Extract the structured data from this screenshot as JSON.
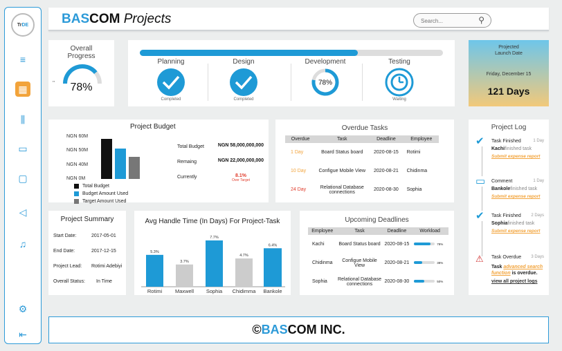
{
  "app": {
    "logo_text_a": "Tr",
    "logo_text_b": "DE",
    "title_blue": "BAS",
    "title_rest": "COM",
    "title_italic": "Projects"
  },
  "search": {
    "placeholder": "Search..."
  },
  "sidebar": {
    "items": [
      "menu-icon",
      "dashboard-icon",
      "filters-icon",
      "calendar-icon",
      "chat-icon",
      "send-icon",
      "bell-icon",
      "settings-icon",
      "collapse-icon"
    ]
  },
  "overall": {
    "title_line1": "Overall",
    "title_line2": "Progress",
    "value": "78%",
    "fraction": 0.78,
    "quote": "''"
  },
  "phases": {
    "progress_fraction": 0.72,
    "items": [
      {
        "name": "Planning",
        "status": "Completed",
        "state": "done"
      },
      {
        "name": "Design",
        "status": "Completed",
        "state": "done"
      },
      {
        "name": "Development",
        "status": "",
        "state": "progress",
        "value": "78%",
        "fraction": 0.78
      },
      {
        "name": "Testing",
        "status": "Waiting",
        "state": "waiting"
      }
    ]
  },
  "launch": {
    "label_line1": "Projected",
    "label_line2": "Launch Date",
    "date": "Friday, December 15",
    "days": "121 Days"
  },
  "budget": {
    "title": "Project Budget",
    "rows": [
      {
        "label": "Total Budget",
        "value": "NGN 58,000,000,000",
        "note": ""
      },
      {
        "label": "Remaing",
        "value": "NGN 22,000,000,000",
        "note": ""
      },
      {
        "label": "Currently",
        "value": "8.1%",
        "note": "Over Target"
      }
    ],
    "legend": [
      "Total Budget",
      "Budget Amount Used",
      "Target Amount Used"
    ]
  },
  "chart_budget": {
    "type": "bar",
    "categories": [
      "Total Budget",
      "Budget Amount Used",
      "Target Amount Used"
    ],
    "values": [
      58,
      44,
      32
    ],
    "ytick_labels": [
      "NGN 60M",
      "NGN 50M",
      "NGN 40M",
      "NGN 0M"
    ],
    "colors": [
      "#111111",
      "#1e9ad6",
      "#777777"
    ]
  },
  "overdue": {
    "title": "Overdue Tasks",
    "headers": [
      "Overdue",
      "Task",
      "Deadline",
      "Employee"
    ],
    "rows": [
      {
        "overdue": "1 Day",
        "task": "Board Status board",
        "deadline": "2020-08-15",
        "employee": "Rotimi",
        "color": "#f2a33a"
      },
      {
        "overdue": "10 Day",
        "task": "Configue Mobile View",
        "deadline": "2020-08-21",
        "employee": "Chidinma",
        "color": "#f2a33a"
      },
      {
        "overdue": "24 Day",
        "task": "Relational Database connections",
        "deadline": "2020-08-30",
        "employee": "Sophia",
        "color": "#e03a2a"
      }
    ]
  },
  "log": {
    "title": "Project Log",
    "entries": [
      {
        "icon": "check-icon",
        "type": "Task Finished",
        "time": "1 Day",
        "who": "Kachi",
        "text": "finished task",
        "link": "Submit expense report"
      },
      {
        "icon": "comment-icon",
        "type": "Comment",
        "time": "1 Day",
        "who": "Bankole",
        "text": "finished task",
        "link": "Submit expense report"
      },
      {
        "icon": "check-icon",
        "type": "Task Finished",
        "time": "2 Days",
        "who": "Sophia",
        "text": "finished task",
        "link": "Submit expense report"
      }
    ],
    "overdue_entry": {
      "type": "Task Overdue",
      "time": "3 Days",
      "prefix": "Task",
      "link": "advanced search function",
      "suffix": "is overdue."
    },
    "view_all": "view all project logs"
  },
  "summary": {
    "title": "Project Summary",
    "rows": [
      {
        "label": "Start Date:",
        "value": "2017-05-01"
      },
      {
        "label": "End Date:",
        "value": "2017-12-15"
      },
      {
        "label": "Project Lead:",
        "value": "Rotimi Adebiyi"
      },
      {
        "label": "Overall Status:",
        "value": "In Time"
      }
    ]
  },
  "chart_data": {
    "type": "bar",
    "title": "Avg Handle Time (In Days)  For Project-Task",
    "categories": [
      "Rotimi",
      "Maxwell",
      "Sophia",
      "Chidimma",
      "Bankole"
    ],
    "values": [
      5.3,
      3.7,
      7.7,
      4.7,
      6.4
    ],
    "value_labels": [
      "5.3%",
      "3.7%",
      "7.7%",
      "4.7%",
      "6.4%"
    ],
    "colors": [
      "#1e9ad6",
      "#cccccc",
      "#1e9ad6",
      "#cccccc",
      "#1e9ad6"
    ],
    "ylim": [
      0,
      8.5
    ]
  },
  "deadlines": {
    "title": "Upcoming Deadlines",
    "headers": [
      "Employee",
      "Task",
      "Deadline",
      "Workload"
    ],
    "rows": [
      {
        "employee": "Kachi",
        "task": "Board Status board",
        "deadline": "2020-08-15",
        "workload": 0.78,
        "workload_label": "78%"
      },
      {
        "employee": "Chidinma",
        "task": "Configue Mobile View",
        "deadline": "2020-08-21",
        "workload": 0.38,
        "workload_label": "38%"
      },
      {
        "employee": "Sophia",
        "task": "Relational Database connections",
        "deadline": "2020-08-30",
        "workload": 0.5,
        "workload_label": "50%"
      }
    ]
  },
  "footer": {
    "copy": "© ",
    "blue": "BAS",
    "rest": "COM INC."
  }
}
